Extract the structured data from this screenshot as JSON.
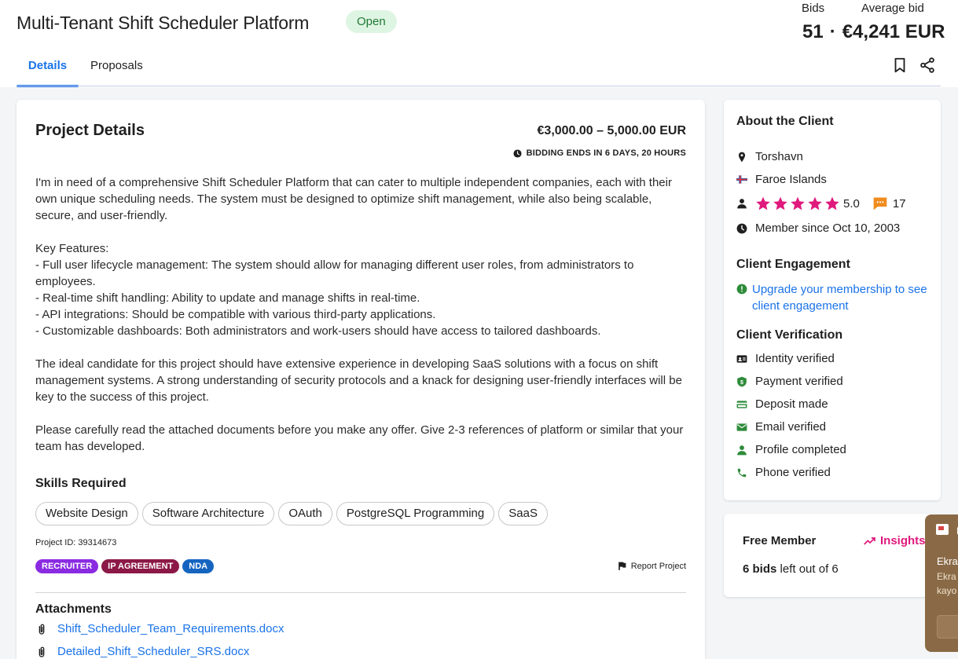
{
  "header": {
    "title": "Multi-Tenant Shift Scheduler Platform",
    "status": "Open",
    "bids_label": "Bids",
    "avg_label": "Average bid",
    "bids_value": "51",
    "separator": "·",
    "avg_value": "€4,241 EUR",
    "tabs": [
      {
        "label": "Details"
      },
      {
        "label": "Proposals"
      }
    ]
  },
  "project": {
    "title": "Project Details",
    "budget": "€3,000.00 – 5,000.00 EUR",
    "bidding_ends": "BIDDING ENDS IN 6 DAYS, 20 HOURS",
    "description": [
      "I'm in need of a comprehensive Shift Scheduler Platform that can cater to multiple independent companies, each with their own unique scheduling needs. The system must be designed to optimize shift management, while also being scalable, secure, and user-friendly.",
      "Key Features:",
      "- Full user lifecycle management: The system should allow for managing different user roles, from administrators to employees.",
      "- Real-time shift handling: Ability to update and manage shifts in real-time.",
      "- API integrations: Should be compatible with various third-party applications.",
      "- Customizable dashboards: Both administrators and work-users should have access to tailored dashboards.",
      "The ideal candidate for this project should have extensive experience in developing SaaS solutions with a focus on shift management systems. A strong understanding of security protocols and a knack for designing user-friendly interfaces will be key to the success of this project.",
      "Please carefully read the attached documents before you make any offer. Give 2-3 references of platform or similar that your team has developed."
    ],
    "skills_title": "Skills Required",
    "skills": [
      "Website Design",
      "Software Architecture",
      "OAuth",
      "PostgreSQL Programming",
      "SaaS"
    ],
    "project_id": "Project ID: 39314673",
    "tags": [
      {
        "label": "RECRUITER",
        "color": "#8a2be2"
      },
      {
        "label": "IP AGREEMENT",
        "color": "#8b1846"
      },
      {
        "label": "NDA",
        "color": "#1565c0"
      }
    ],
    "report": "Report Project",
    "attachments_title": "Attachments",
    "attachments": [
      "Shift_Scheduler_Team_Requirements.docx",
      "Detailed_Shift_Scheduler_SRS.docx"
    ]
  },
  "client": {
    "title": "About the Client",
    "city": "Torshavn",
    "country": "Faroe Islands",
    "rating": "5.0",
    "reviews": "17",
    "member_since": "Member since Oct 10, 2003",
    "engagement_title": "Client Engagement",
    "engagement_link": "Upgrade your membership to see client engagement",
    "verification_title": "Client Verification",
    "verifications": [
      "Identity verified",
      "Payment verified",
      "Deposit made",
      "Email verified",
      "Profile completed",
      "Phone verified"
    ],
    "star_color": "#e0197d",
    "verified_color": "#2e8b3a"
  },
  "membership": {
    "title": "Free Member",
    "insights": "Insights",
    "bids_left_bold": "6 bids",
    "bids_left_rest": " left out of 6"
  },
  "toast": {
    "line1": "Ekra",
    "line2": "Ekra",
    "line3": "kayo",
    "corner": "E"
  }
}
